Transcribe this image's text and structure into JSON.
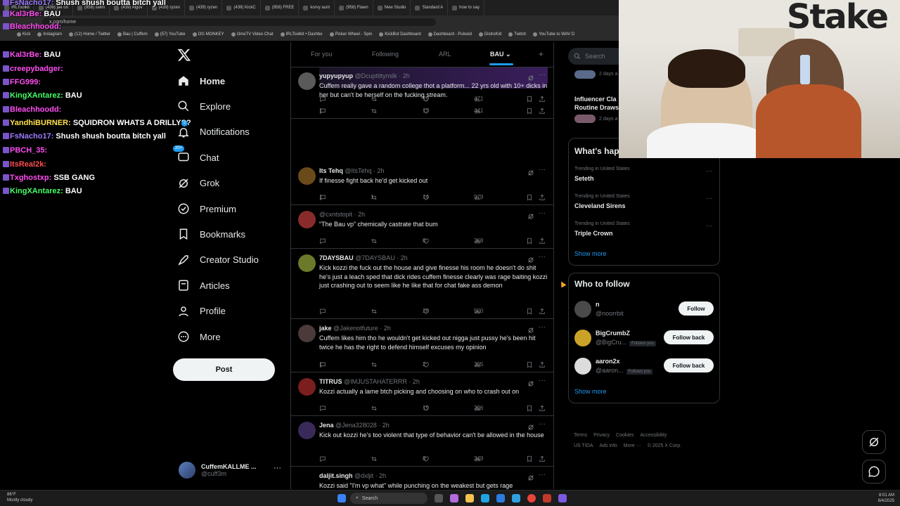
{
  "browser": {
    "tabs": [
      "IRLToolkit",
      "(438) jae on",
      "(958) swim",
      "(439) Algov",
      "(439) ryzen",
      "(439) ryzen",
      "(439) KickC",
      "(958) FREE",
      "korvy aunt",
      "(958) Flawn",
      "New Studio",
      "Standard A",
      "how to say"
    ],
    "url": "x.com/home",
    "bookmarks": [
      "Kick",
      "Instagram",
      "(12) Home / Twitter",
      "Bau | Cuffem",
      "(57) YouTube",
      "OG MONKEY",
      "OmeTV Video Chat",
      "IRLToolkit • Dashbo",
      "Picker Wheel - Spin",
      "KickBot Dashboard",
      "Dashboard - Pulsoid",
      "DistroKid",
      "Twitch",
      "YouTube to WAV D"
    ]
  },
  "chat": [
    {
      "user": "FsNacho17:",
      "text": "Shush shush boutta bitch yall",
      "color": "#9b7bff"
    },
    {
      "user": "Kal3rBe:",
      "text": "BAU",
      "color": "#ff4df2"
    },
    {
      "user": "Bleachhoodd:",
      "text": "",
      "color": "#ff4df2"
    },
    {
      "user": "Kal3rBe:",
      "text": "BAU",
      "color": "#ff4df2"
    },
    {
      "user": "creepybadger:",
      "text": "",
      "color": "#ff4df2"
    },
    {
      "user": "FFG999:",
      "text": "",
      "color": "#ff4df2"
    },
    {
      "user": "KingXAntarez:",
      "text": "BAU",
      "color": "#44ff66"
    },
    {
      "user": "Bleachhoodd:",
      "text": "",
      "color": "#ff4df2"
    },
    {
      "user": "YandhiBURNER:",
      "text": "SQUIDRON WHATS A DRILLYS?",
      "color": "#ffe14d"
    },
    {
      "user": "FsNacho17:",
      "text": "Shush shush boutta bitch yall",
      "color": "#9b7bff"
    },
    {
      "user": "PBCH_35:",
      "text": "",
      "color": "#ff4df2"
    },
    {
      "user": "ItsReal2k:",
      "text": "",
      "color": "#ff4d4d"
    },
    {
      "user": "Txghostxp:",
      "text": "SSB GANG",
      "color": "#ff4df2"
    },
    {
      "user": "KingXAntarez:",
      "text": "BAU",
      "color": "#44ff66"
    }
  ],
  "sidebar": {
    "items": [
      {
        "label": "Home"
      },
      {
        "label": "Explore"
      },
      {
        "label": "Notifications",
        "badge": "2"
      },
      {
        "label": "Chat",
        "badge": "20+"
      },
      {
        "label": "Grok"
      },
      {
        "label": "Premium"
      },
      {
        "label": "Bookmarks"
      },
      {
        "label": "Creator Studio"
      },
      {
        "label": "Articles"
      },
      {
        "label": "Profile"
      },
      {
        "label": "More"
      }
    ],
    "post_label": "Post",
    "account": {
      "name": "CuffemKALLME ...",
      "handle": "@cuff3m"
    }
  },
  "timeline": {
    "tabs": [
      "For you",
      "Following",
      "ARL",
      "BAU"
    ],
    "top_actions": {
      "replies": "",
      "retweets": "",
      "likes": "19",
      "views": "471"
    },
    "tweets": [
      {
        "name": "yupyupyup",
        "handle": "@Dcuptittymilk",
        "time": "2h",
        "text": "Cuffem really gave a random college thot a platform... 22 yrs old with 10+ dicks in her but can't be herself on the fucking stream.",
        "replies": "1",
        "retweets": "",
        "likes": "13",
        "views": "441",
        "avatar": "#5a5a5a"
      },
      {
        "name": "Its Tehq",
        "handle": "@ItsTehq",
        "time": "2h",
        "text": "If finesse fight back he'd get kicked out",
        "replies": "1",
        "retweets": "1",
        "likes": "14",
        "views": "979",
        "avatar": "#6b4a1a"
      },
      {
        "name": "",
        "handle": "@cxntstopit",
        "time": "2h",
        "text": "“The Bau vp” chemically castrate that bum",
        "replies": "",
        "retweets": "",
        "likes": "8",
        "views": "368",
        "avatar": "#8a2b2b"
      },
      {
        "name": "7DAYSBAU",
        "handle": "@7DAYSBAU",
        "time": "2h",
        "text": "Kick kozzi the fuck out the house and give finesse his room he doesn't do shit he's just a leach sped that dick rides cuffem finesse clearly was rage baiting kozzi just crashing out to seem like he like that for chat fake ass demon",
        "replies": "",
        "retweets": "",
        "likes": "28",
        "views": "500",
        "avatar": "#6a7a2a"
      },
      {
        "name": "jake",
        "handle": "@Jakenotfuture",
        "time": "2h",
        "text": "Cuffem likes him tho he wouldn't get kicked out nigga just pussy he's been hit twice he has the right to defend himself excuses my opinion",
        "replies": "1",
        "retweets": "",
        "likes": "2",
        "views": "395",
        "avatar": "#4a3a3a"
      },
      {
        "name": "TITRUS",
        "handle": "@IMJUSTAHATERRR",
        "time": "2h",
        "text": "Kozzi actually a lame btch picking and choosing on  who to crash out on",
        "replies": "",
        "retweets": "",
        "likes": "15",
        "views": "396",
        "avatar": "#7a1e1e"
      },
      {
        "name": "Jena",
        "handle": "@Jena328028",
        "time": "2h",
        "text": "Kick out kozzi he's too violent that type of behavior can't be allowed in the house",
        "replies": "",
        "retweets": "",
        "likes": "8",
        "views": "349",
        "avatar": "#3a2a5a"
      },
      {
        "name": "daljit.singh",
        "handle": "@dxljit",
        "time": "2h",
        "text": "Kozzi said \"I'm vp what\" while punching on the weakest but gets rage",
        "replies": "",
        "retweets": "",
        "likes": "",
        "views": "",
        "avatar": "#000000"
      }
    ]
  },
  "right": {
    "search_placeholder": "Search",
    "news": [
      {
        "title": "",
        "meta": "2 days a"
      },
      {
        "title": "Influencer Cla Routine Draws",
        "meta": "2 days a"
      }
    ],
    "happening_title": "What's hap",
    "trends": [
      {
        "context": "Trending in United States",
        "name": "Seteth"
      },
      {
        "context": "Trending in United States",
        "name": "Cleveland Sirens"
      },
      {
        "context": "Trending in United States",
        "name": "Triple Crown"
      }
    ],
    "show_more": "Show more",
    "who_title": "Who to follow",
    "follow": [
      {
        "name": "n",
        "handle": "@noorrbit",
        "follows_you": "",
        "button": "Follow"
      },
      {
        "name": "BigCrumbZ",
        "handle": "@BigCru...",
        "follows_you": "Follows you",
        "button": "Follow back"
      },
      {
        "name": "aaron2x",
        "handle": "@aaron...",
        "follows_you": "Follows you",
        "button": "Follow back"
      }
    ],
    "footer": [
      "Terms",
      "Privacy",
      "Cookies",
      "Accessibility",
      "US TIDA",
      "Ads info",
      "More ···",
      "© 2025 X Corp."
    ]
  },
  "webcam": {
    "logo": "Stake"
  },
  "taskbar": {
    "weather_temp": "86°F",
    "weather_desc": "Mostly cloudy",
    "search": "Search",
    "time": "8:01 AM",
    "date": "8/4/2025"
  }
}
